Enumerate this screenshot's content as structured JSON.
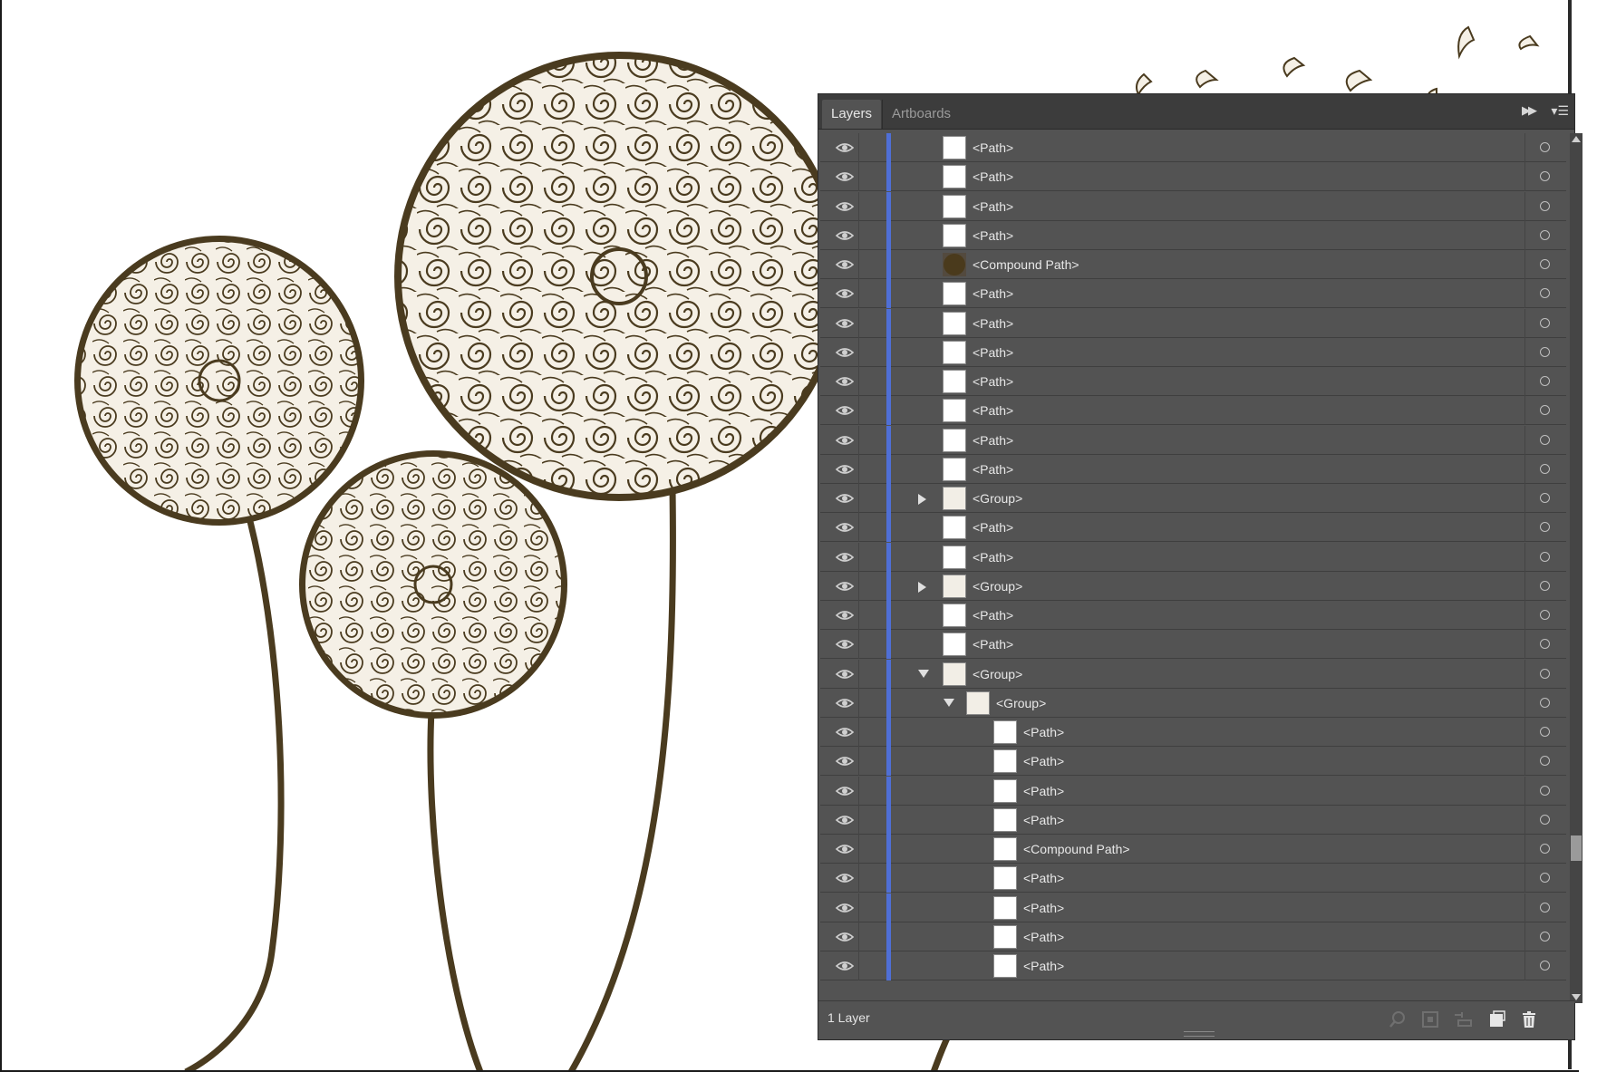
{
  "panel": {
    "tabs": [
      {
        "label": "Layers",
        "active": true
      },
      {
        "label": "Artboards",
        "active": false
      }
    ],
    "collapse_icon": "double-chevron-right-icon",
    "menu_icon": "panel-menu-icon",
    "layer_color": "#4f6fd6",
    "rows": [
      {
        "label": "<Path>",
        "kind": "path",
        "indent": 0,
        "expander": "none"
      },
      {
        "label": "<Path>",
        "kind": "path",
        "indent": 0,
        "expander": "none"
      },
      {
        "label": "<Path>",
        "kind": "path",
        "indent": 0,
        "expander": "none"
      },
      {
        "label": "<Path>",
        "kind": "path",
        "indent": 0,
        "expander": "none"
      },
      {
        "label": "<Compound Path>",
        "kind": "compound",
        "indent": 0,
        "expander": "none"
      },
      {
        "label": "<Path>",
        "kind": "path",
        "indent": 0,
        "expander": "none"
      },
      {
        "label": "<Path>",
        "kind": "path",
        "indent": 0,
        "expander": "none"
      },
      {
        "label": "<Path>",
        "kind": "path",
        "indent": 0,
        "expander": "none"
      },
      {
        "label": "<Path>",
        "kind": "path",
        "indent": 0,
        "expander": "none"
      },
      {
        "label": "<Path>",
        "kind": "path",
        "indent": 0,
        "expander": "none"
      },
      {
        "label": "<Path>",
        "kind": "path",
        "indent": 0,
        "expander": "none"
      },
      {
        "label": "<Path>",
        "kind": "path",
        "indent": 0,
        "expander": "none"
      },
      {
        "label": "<Group>",
        "kind": "group",
        "indent": 0,
        "expander": "collapsed"
      },
      {
        "label": "<Path>",
        "kind": "path",
        "indent": 0,
        "expander": "none"
      },
      {
        "label": "<Path>",
        "kind": "path",
        "indent": 0,
        "expander": "none"
      },
      {
        "label": "<Group>",
        "kind": "group",
        "indent": 0,
        "expander": "collapsed"
      },
      {
        "label": "<Path>",
        "kind": "path",
        "indent": 0,
        "expander": "none"
      },
      {
        "label": "<Path>",
        "kind": "path",
        "indent": 0,
        "expander": "none"
      },
      {
        "label": "<Group>",
        "kind": "group",
        "indent": 0,
        "expander": "expanded"
      },
      {
        "label": "<Group>",
        "kind": "group",
        "indent": 1,
        "expander": "expanded"
      },
      {
        "label": "<Path>",
        "kind": "path",
        "indent": 2,
        "expander": "none"
      },
      {
        "label": "<Path>",
        "kind": "path",
        "indent": 2,
        "expander": "none"
      },
      {
        "label": "<Path>",
        "kind": "path",
        "indent": 2,
        "expander": "none"
      },
      {
        "label": "<Path>",
        "kind": "path",
        "indent": 2,
        "expander": "none"
      },
      {
        "label": "<Compound Path>",
        "kind": "path",
        "indent": 2,
        "expander": "none"
      },
      {
        "label": "<Path>",
        "kind": "path",
        "indent": 2,
        "expander": "none"
      },
      {
        "label": "<Path>",
        "kind": "path",
        "indent": 2,
        "expander": "none"
      },
      {
        "label": "<Path>",
        "kind": "path",
        "indent": 2,
        "expander": "none"
      },
      {
        "label": "<Path>",
        "kind": "path",
        "indent": 2,
        "expander": "none"
      }
    ],
    "footer": {
      "layer_count": "1 Layer",
      "icons": [
        "locate-object-icon",
        "make-clipping-mask-icon",
        "create-sublayer-icon",
        "new-layer-icon",
        "delete-icon"
      ]
    }
  },
  "artwork": {
    "ink_color": "#4a3b1f",
    "subject": "dandelion-illustration"
  }
}
